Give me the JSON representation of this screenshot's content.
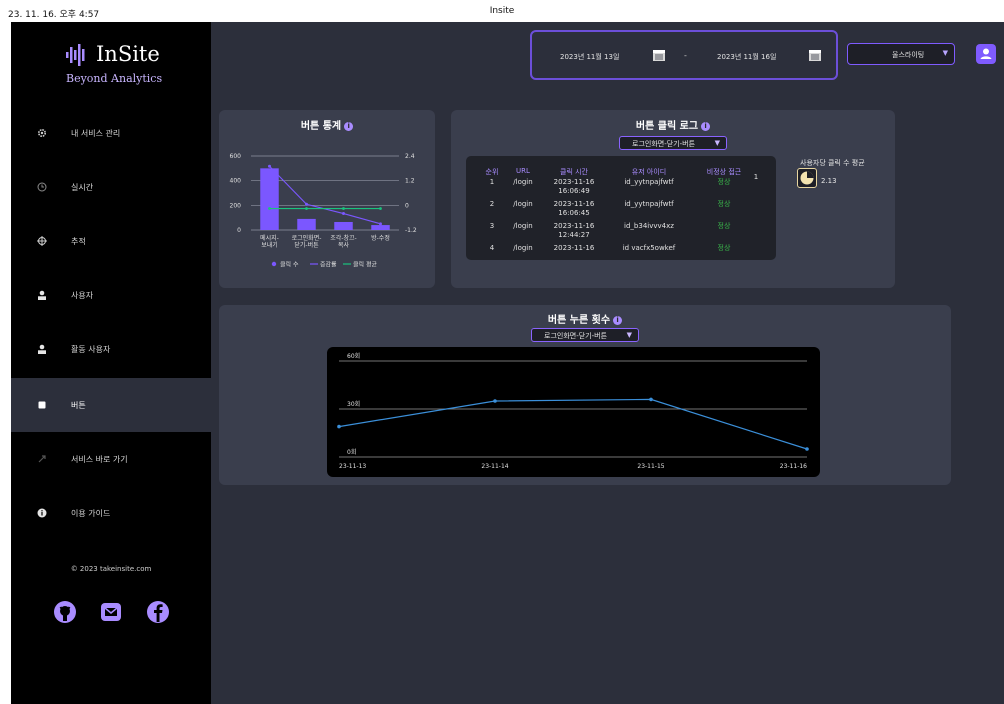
{
  "print_header": {
    "date": "23. 11. 16. 오후 4:57",
    "title": "Insite"
  },
  "brand": {
    "name": "InSite",
    "tagline": "Beyond Analytics"
  },
  "sidebar": {
    "items": [
      {
        "label": "내 서비스 관리",
        "icon": "gear-icon"
      },
      {
        "label": "실시간",
        "icon": "clock-icon"
      },
      {
        "label": "추적",
        "icon": "crosshair-icon"
      },
      {
        "label": "사용자",
        "icon": "user-icon"
      },
      {
        "label": "활동 사용자",
        "icon": "user-icon"
      },
      {
        "label": "버튼",
        "icon": "square-icon"
      },
      {
        "label": "서비스 바로 가기",
        "icon": "link-icon"
      },
      {
        "label": "이용 가이드",
        "icon": "info-icon"
      }
    ],
    "copyright": "© 2023 takeinsite.com",
    "social": [
      "github-icon",
      "mail-icon",
      "facebook-icon"
    ]
  },
  "header": {
    "start_date": "2023년 11월 13일",
    "separator": "-",
    "end_date": "2023년 11월 16일",
    "service": "울스라이팅"
  },
  "button_stats": {
    "title": "버튼 통계",
    "info": "i",
    "chart_data": {
      "type": "bar",
      "categories": [
        [
          "메시지-",
          "보내기"
        ],
        [
          "로그인화면-",
          "닫기-버튼"
        ],
        [
          "조각-창끄-",
          "복사"
        ],
        [
          "방-수정"
        ]
      ],
      "series": [
        {
          "name": "클릭 수",
          "type": "bar",
          "axis": "left",
          "values": [
            500,
            90,
            65,
            40
          ]
        },
        {
          "name": "증감률",
          "type": "line",
          "axis": "right",
          "values": [
            1.9,
            0.05,
            -0.4,
            -0.9
          ]
        },
        {
          "name": "클릭 평균",
          "type": "line",
          "axis": "left",
          "values": [
            174,
            174,
            174,
            174
          ]
        }
      ],
      "y_left": {
        "ticks": [
          "600",
          "400",
          "200",
          "0"
        ],
        "range": [
          0,
          600
        ]
      },
      "y_right": {
        "ticks": [
          "2.4",
          "1.2",
          "0",
          "-1.2"
        ],
        "range": [
          -1.2,
          2.4
        ]
      },
      "legend": [
        "클릭 수",
        "증감률",
        "클릭 평균"
      ],
      "colors": {
        "bar": "#7b57ff",
        "rate": "#7b57ff",
        "avg": "#19c37d"
      }
    }
  },
  "click_log": {
    "title": "버튼 클릭 로그",
    "info": "i",
    "select": "로그인화면-닫기-버튼",
    "headers": [
      "순위",
      "URL",
      "클릭 시간",
      "유저 아이디",
      "비정상 접근"
    ],
    "rows": [
      {
        "rank": "1",
        "url": "/login",
        "time": [
          "2023-11-16",
          "16:06:49"
        ],
        "user": "id_yytnpajfwtf",
        "status": "정상"
      },
      {
        "rank": "2",
        "url": "/login",
        "time": [
          "2023-11-16",
          "16:06:45"
        ],
        "user": "id_yytnpajfwtf",
        "status": "정상"
      },
      {
        "rank": "3",
        "url": "/login",
        "time": [
          "2023-11-16",
          "12:44:27"
        ],
        "user": "id_b34ivvv4xz",
        "status": "정상"
      },
      {
        "rank": "4",
        "url": "/login",
        "time": [
          "2023-11-16",
          ""
        ],
        "user": "id vacfx5owkef",
        "status": "정상"
      }
    ],
    "page_marker": "1",
    "avg_label": "사용자당 클릭 수 평균",
    "avg_value": "2.13"
  },
  "press_count": {
    "title": "버튼 누른 횟수",
    "info": "i",
    "select": "로그인화면-닫기-버튼",
    "chart_data": {
      "type": "line",
      "x": [
        "23-11-13",
        "23-11-14",
        "23-11-15",
        "23-11-16"
      ],
      "values": [
        19,
        35,
        36,
        5
      ],
      "y_ticks": [
        "60회",
        "30회",
        "0회"
      ],
      "ylim": [
        0,
        60
      ],
      "color": "#3b8fd9",
      "grid": true
    }
  }
}
